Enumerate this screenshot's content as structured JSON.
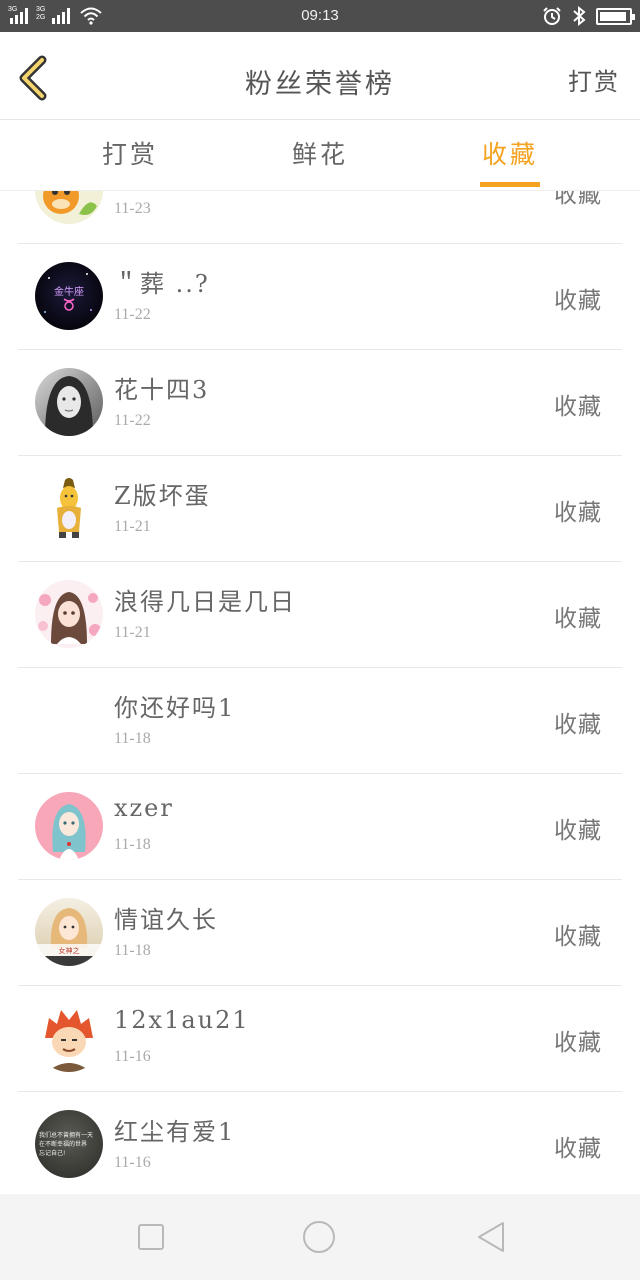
{
  "status_bar": {
    "time": "09:13",
    "sim1_label": "3G",
    "sim2_label_top": "3G",
    "sim2_label_bottom": "2G",
    "battery_level": 0.95
  },
  "header": {
    "title": "粉丝荣誉榜",
    "right_action": "打赏"
  },
  "tabs": [
    {
      "label": "打赏",
      "active": false
    },
    {
      "label": "鲜花",
      "active": false
    },
    {
      "label": "收藏",
      "active": true
    }
  ],
  "list": [
    {
      "name": "",
      "date": "11-23",
      "action": "收藏",
      "avatar": "cartoon-dog-avatar"
    },
    {
      "name": "＂葬 ..?",
      "date": "11-22",
      "action": "收藏",
      "avatar": "taurus-galaxy-avatar"
    },
    {
      "name": "花十四3",
      "date": "11-22",
      "action": "收藏",
      "avatar": "bw-girl-portrait-avatar"
    },
    {
      "name": "Z版坏蛋",
      "date": "11-21",
      "action": "收藏",
      "avatar": "banana-figure-avatar"
    },
    {
      "name": "浪得几日是几日",
      "date": "11-21",
      "action": "收藏",
      "avatar": "anime-girl-flowers-avatar"
    },
    {
      "name": "你还好吗1",
      "date": "11-18",
      "action": "收藏",
      "avatar": ""
    },
    {
      "name": "xzer",
      "date": "11-18",
      "action": "收藏",
      "avatar": "anime-girl-pink-avatar"
    },
    {
      "name": "情谊久长",
      "date": "11-18",
      "action": "收藏",
      "avatar": "girl-photo-avatar"
    },
    {
      "name": "12x1au21",
      "date": "11-16",
      "action": "收藏",
      "avatar": "redhead-cartoon-avatar"
    },
    {
      "name": "红尘有爱1",
      "date": "11-16",
      "action": "收藏",
      "avatar": "quote-text-avatar"
    }
  ],
  "avatar_texts": {
    "taurus": "金牛座",
    "quote_line1": "我们总不曾拥有一天",
    "quote_line2": "在不断幸福的世界",
    "quote_line3": "忘记自己!",
    "girl_photo": "女神之"
  },
  "colors": {
    "accent": "#f4a21f",
    "status_bar": "#4d4d4d",
    "divider": "#e8e8e8"
  }
}
